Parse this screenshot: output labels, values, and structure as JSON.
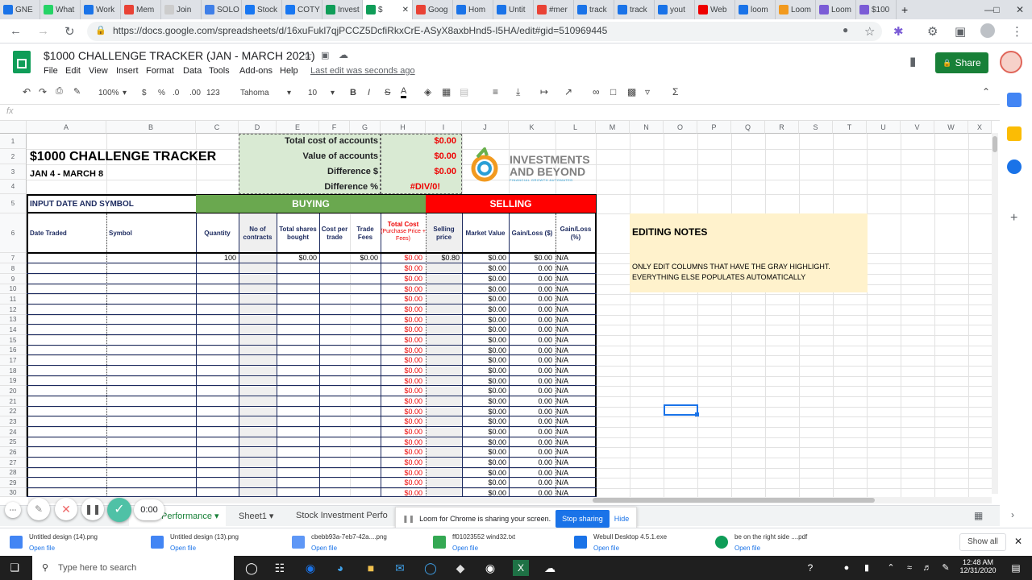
{
  "browser": {
    "tabs": [
      "GNE",
      "What",
      "Work",
      "Mem",
      "Join",
      "SOLO",
      "Stock",
      "COTY",
      "Invest",
      "$",
      "Goog",
      "Hom",
      "Untit",
      "#mer",
      "track",
      "track",
      "yout",
      "Web",
      "loom",
      "Loom",
      "Loom",
      "$100"
    ],
    "active_tab_index": 9,
    "url": "https://docs.google.com/spreadsheets/d/16xuFukl7qjPCCZ5DcfiRkxCrE-ASyX8axbHnd5-I5HA/edit#gid=510969445"
  },
  "sheets": {
    "title": "$1000 CHALLENGE TRACKER (JAN - MARCH 2021)",
    "menu": [
      "File",
      "Edit",
      "View",
      "Insert",
      "Format",
      "Data",
      "Tools",
      "Add-ons",
      "Help"
    ],
    "last_edit": "Last edit was seconds ago",
    "share_label": "Share",
    "toolbar": {
      "zoom": "100%",
      "currency": "$",
      "percent": "%",
      "dec_dec": ".0",
      "dec_inc": ".00",
      "format": "123",
      "font": "Tahoma",
      "size": "10"
    },
    "fx_label": "fx"
  },
  "columns": [
    "A",
    "B",
    "C",
    "D",
    "E",
    "F",
    "G",
    "H",
    "I",
    "J",
    "K",
    "L",
    "M",
    "N",
    "O",
    "P",
    "Q",
    "R",
    "S",
    "T",
    "U",
    "V",
    "W",
    "X"
  ],
  "rows": [
    "1",
    "2",
    "3",
    "4",
    "5",
    "6",
    "7",
    "8",
    "9",
    "10",
    "11",
    "12",
    "13",
    "14",
    "15",
    "16",
    "17",
    "18",
    "19",
    "20",
    "21",
    "22",
    "23",
    "24",
    "25",
    "26",
    "27",
    "28",
    "29",
    "30"
  ],
  "summary": {
    "labels": [
      "Total cost of accounts",
      "Value of accounts",
      "Difference $",
      "Difference %"
    ],
    "values": [
      "$0.00",
      "$0.00",
      "$0.00",
      "#DIV/0!"
    ]
  },
  "header": {
    "title": "$1000 CHALLENGE TRACKER",
    "subtitle": "JAN 4 - MARCH 8",
    "input_label": "INPUT DATE AND SYMBOL",
    "buying": "BUYING",
    "selling": "SELLING"
  },
  "logo": {
    "line1": "INVESTMENTS",
    "line2": "AND BEYOND",
    "tag": "FINANCIAL GROWTH AUTOMATED"
  },
  "col_headers": {
    "date": "Date Traded",
    "symbol": "Symbol",
    "qty": "Quantity",
    "contracts": "No of contracts",
    "shares": "Total shares bought",
    "cost": "Cost per trade",
    "fees": "Trade Fees",
    "total": "Total Cost",
    "total_sub": "(Purchase Price + Fees)",
    "sell": "Selling price",
    "market": "Market Value",
    "gl_dollar": "Gain/Loss ($)",
    "gl_pct": "Gain/Loss (%)"
  },
  "first_row": {
    "qty": "100",
    "shares": "$0.00",
    "fees": "$0.00",
    "total": "$0.00",
    "sell": "$0.80",
    "market": "$0.00",
    "gl": "$0.00",
    "pct": "N/A"
  },
  "repeat_row": {
    "total": "$0.00",
    "market": "$0.00",
    "gl": "0.00",
    "pct": "N/A"
  },
  "notes": {
    "title": "EDITING NOTES",
    "body1": "ONLY EDIT COLUMNS THAT HAVE THE GRAY HIGHLIGHT.",
    "body2": "EVERYTHING ELSE POPULATES AUTOMATICALLY"
  },
  "sheet_tabs": {
    "current": "Performance",
    "t2": "Sheet1",
    "t3": "Stock Investment Perfo"
  },
  "recorder": {
    "time": "0:00"
  },
  "share_notice": {
    "text": "Loom for Chrome is sharing your screen.",
    "stop": "Stop sharing",
    "hide": "Hide"
  },
  "downloads": [
    {
      "name": "Untitled design (14).png",
      "open": "Open file"
    },
    {
      "name": "Untitled design (13).png",
      "open": "Open file"
    },
    {
      "name": "cbebb93a-7eb7-42a....png",
      "open": "Open file"
    },
    {
      "name": "ff01023552 wind32.txt",
      "open": "Open file"
    },
    {
      "name": "Webull Desktop 4.5.1.exe",
      "open": "Open file"
    },
    {
      "name": "be on the right side ....pdf",
      "open": "Open file"
    }
  ],
  "show_all": "Show all",
  "taskbar": {
    "search": "Type here to search",
    "time": "12:48 AM",
    "date": "12/31/2020"
  },
  "colors": {
    "green": "#6aa84f",
    "red": "#ff0000",
    "gray": "#efefef",
    "light_green": "#d9ead3",
    "note": "#fff2cc",
    "share": "#188038"
  }
}
